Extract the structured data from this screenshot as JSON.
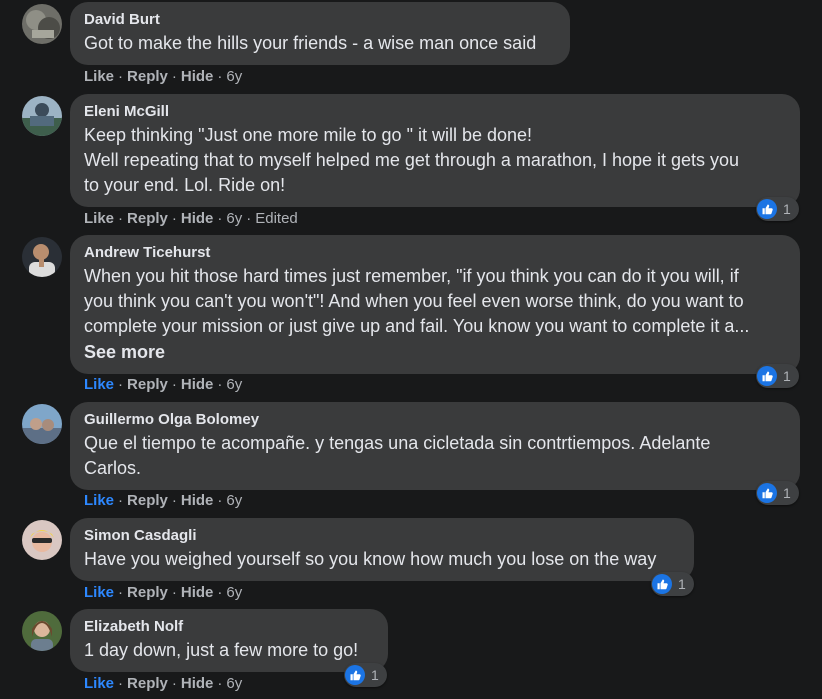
{
  "labels": {
    "like": "Like",
    "reply": "Reply",
    "hide": "Hide",
    "dot": "·"
  },
  "comments": [
    {
      "author": "David Burt",
      "text": "Got to make the hills your friends - a wise man once said",
      "time": "6y",
      "edited": "",
      "see_more": "",
      "like_blue": false,
      "reactions": ""
    },
    {
      "author": "Eleni McGill",
      "text": "Keep thinking \"Just one more mile to go \" it will be done!\nWell repeating that to myself helped me get through a marathon, I hope it gets you\nto your end. Lol. Ride on!",
      "time": "6y",
      "edited": "Edited",
      "see_more": "",
      "like_blue": false,
      "reactions": "1"
    },
    {
      "author": "Andrew Ticehurst",
      "text": "When you hit those hard times just remember, \"if you think you can do it you will, if\nyou think you can't you won't\"! And when you feel even worse think, do you want to\ncomplete your mission or just give up and fail. You know you want to complete it a...",
      "time": "6y",
      "edited": "",
      "see_more": "See more",
      "like_blue": true,
      "reactions": "1"
    },
    {
      "author": "Guillermo Olga Bolomey",
      "text": "Que el tiempo te acompañe. y tengas una cicletada sin contrtiempos. Adelante\nCarlos.",
      "time": "6y",
      "edited": "",
      "see_more": "",
      "like_blue": true,
      "reactions": "1"
    },
    {
      "author": "Simon Casdagli",
      "text": "Have you weighed yourself so you know how much you lose on the way",
      "time": "6y",
      "edited": "",
      "see_more": "",
      "like_blue": true,
      "reactions": "1"
    },
    {
      "author": "Elizabeth Nolf",
      "text": "1 day down, just a few more to go!",
      "time": "6y",
      "edited": "",
      "see_more": "",
      "like_blue": true,
      "reactions": "1"
    }
  ],
  "icons": {
    "reaction": "like-thumbs-up-icon",
    "avatar": "avatar"
  }
}
